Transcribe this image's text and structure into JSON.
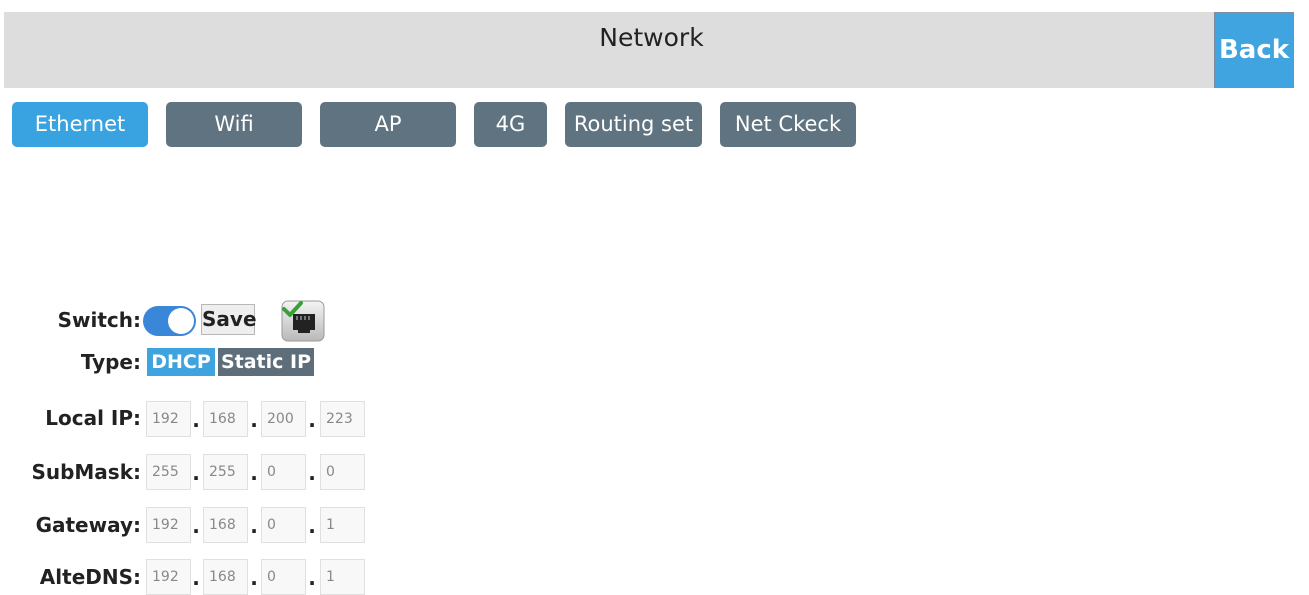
{
  "header": {
    "title": "Network",
    "back_label": "Back"
  },
  "tabs": [
    {
      "label": "Ethernet",
      "active": true
    },
    {
      "label": "Wifi",
      "active": false
    },
    {
      "label": "AP",
      "active": false
    },
    {
      "label": "4G",
      "active": false
    },
    {
      "label": "Routing set",
      "active": false
    },
    {
      "label": "Net Ckeck",
      "active": false
    }
  ],
  "ethernet": {
    "switch_label": "Switch:",
    "switch_on": true,
    "save_label": "Save",
    "status_icon": "network-connected-icon",
    "type_label": "Type:",
    "type_options": [
      "DHCP",
      "Static IP"
    ],
    "type_selected": "DHCP",
    "fields": [
      {
        "label": "Local IP:",
        "octets": [
          "192",
          "168",
          "200",
          "223"
        ]
      },
      {
        "label": "SubMask:",
        "octets": [
          "255",
          "255",
          "0",
          "0"
        ]
      },
      {
        "label": "Gateway:",
        "octets": [
          "192",
          "168",
          "0",
          "1"
        ]
      },
      {
        "label": "AlteDNS:",
        "octets": [
          "192",
          "168",
          "0",
          "1"
        ]
      }
    ]
  },
  "colors": {
    "accent": "#38a3e0",
    "tab_inactive": "#5f7380",
    "header_bg": "#dddddd",
    "toggle_on": "#3a86d9"
  }
}
